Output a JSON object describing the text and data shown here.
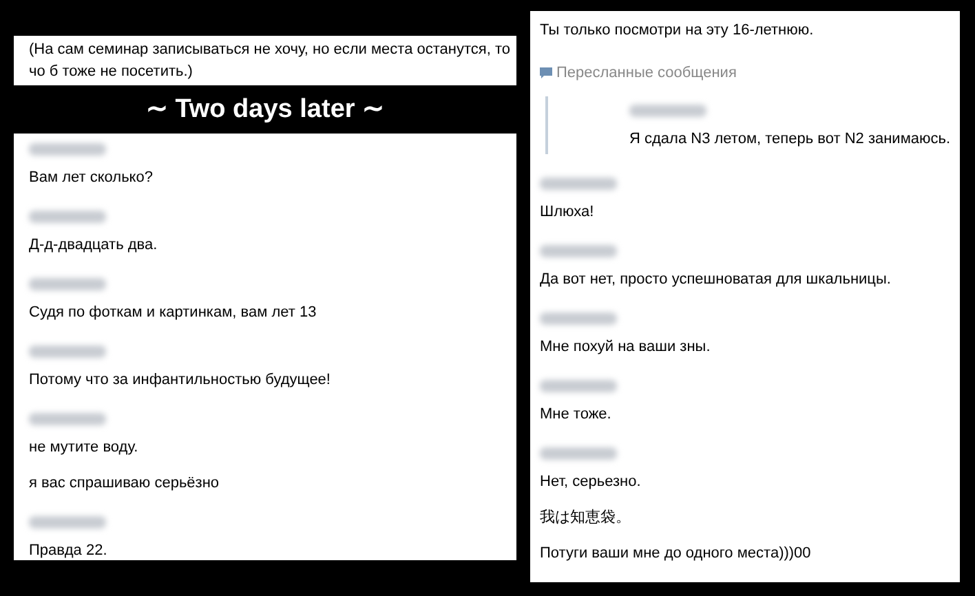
{
  "top_note": {
    "text": "(На сам семинар записываться не хочу, но если места останутся, то чо б тоже не посетить.)"
  },
  "caption": {
    "text": "∼ Two days later ∼"
  },
  "left_chat": {
    "messages": [
      {
        "kind": "named",
        "text": "Вам лет сколько?"
      },
      {
        "kind": "named",
        "text": "Д-д-двадцать два."
      },
      {
        "kind": "named",
        "text": "Судя по фоткам и картинкам, вам лет 13"
      },
      {
        "kind": "named",
        "text": "Потому что за инфантильностью будущее!"
      },
      {
        "kind": "named",
        "text": "не мутите воду."
      },
      {
        "kind": "plain",
        "text": "я вас спрашиваю серьёзно"
      },
      {
        "kind": "named",
        "text": "Правда 22."
      }
    ]
  },
  "right_chat": {
    "messages": [
      {
        "kind": "plain",
        "text": "Ты только посмотри на эту 16-летнюю."
      },
      {
        "kind": "forwarded",
        "header": "Пересланные сообщения",
        "text": "Я сдала N3 летом, теперь вот N2 занимаюсь."
      },
      {
        "kind": "named",
        "text": "Шлюха!"
      },
      {
        "kind": "named",
        "text": "Да вот нет, просто успешноватая для шкальницы."
      },
      {
        "kind": "named",
        "text": "Мне похуй на ваши зны."
      },
      {
        "kind": "named",
        "text": "Мне тоже."
      },
      {
        "kind": "named",
        "text": "Нет, серьезно."
      },
      {
        "kind": "plain",
        "text": "我は知恵袋。"
      },
      {
        "kind": "plain",
        "text": "Потуги ваши мне до одного места)))00"
      }
    ]
  }
}
